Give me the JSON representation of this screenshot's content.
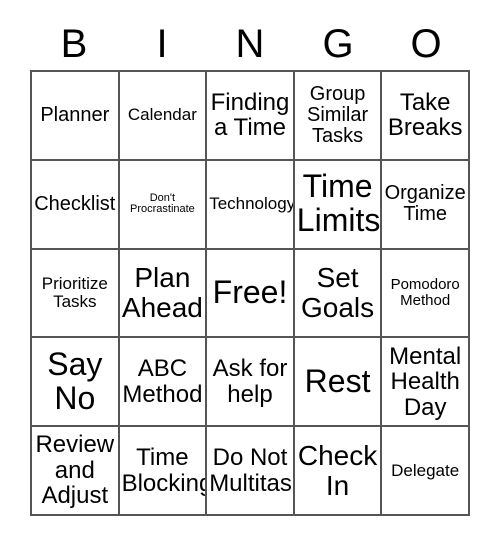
{
  "header": {
    "letters": [
      "B",
      "I",
      "N",
      "G",
      "O"
    ]
  },
  "colors": {
    "grid_border": "#555555",
    "cell_background": "#ffffff",
    "text": "#000000",
    "page_background": "#ffffff"
  },
  "grid": {
    "columns": 5,
    "rows": 5,
    "free_space": "Free!",
    "cells": [
      [
        {
          "text": "Planner",
          "size": "lg"
        },
        {
          "text": "Calendar",
          "size": "md"
        },
        {
          "text": "Finding\na Time",
          "size": "xl"
        },
        {
          "text": "Group\nSimilar\nTasks",
          "size": "lg"
        },
        {
          "text": "Take\nBreaks",
          "size": "xl"
        }
      ],
      [
        {
          "text": "Checklist",
          "size": "lg"
        },
        {
          "text": "Don't\nProcrastinate",
          "size": "xs"
        },
        {
          "text": "Technology",
          "size": "md"
        },
        {
          "text": "Time\nLimits",
          "size": "huge"
        },
        {
          "text": "Organize\nTime",
          "size": "lg"
        }
      ],
      [
        {
          "text": "Prioritize\nTasks",
          "size": "md"
        },
        {
          "text": "Plan\nAhead",
          "size": "xxl"
        },
        {
          "text": "Free!",
          "size": "huge"
        },
        {
          "text": "Set\nGoals",
          "size": "xxl"
        },
        {
          "text": "Pomodoro\nMethod",
          "size": "sm"
        }
      ],
      [
        {
          "text": "Say\nNo",
          "size": "huge"
        },
        {
          "text": "ABC\nMethod",
          "size": "xl"
        },
        {
          "text": "Ask for\nhelp",
          "size": "xl"
        },
        {
          "text": "Rest",
          "size": "huge"
        },
        {
          "text": "Mental\nHealth\nDay",
          "size": "xl"
        }
      ],
      [
        {
          "text": "Review\nand\nAdjust",
          "size": "xl"
        },
        {
          "text": "Time\nBlocking",
          "size": "xl"
        },
        {
          "text": "Do Not\nMultitask",
          "size": "xl"
        },
        {
          "text": "Check\nIn",
          "size": "xxl"
        },
        {
          "text": "Delegate",
          "size": "md"
        }
      ]
    ]
  }
}
